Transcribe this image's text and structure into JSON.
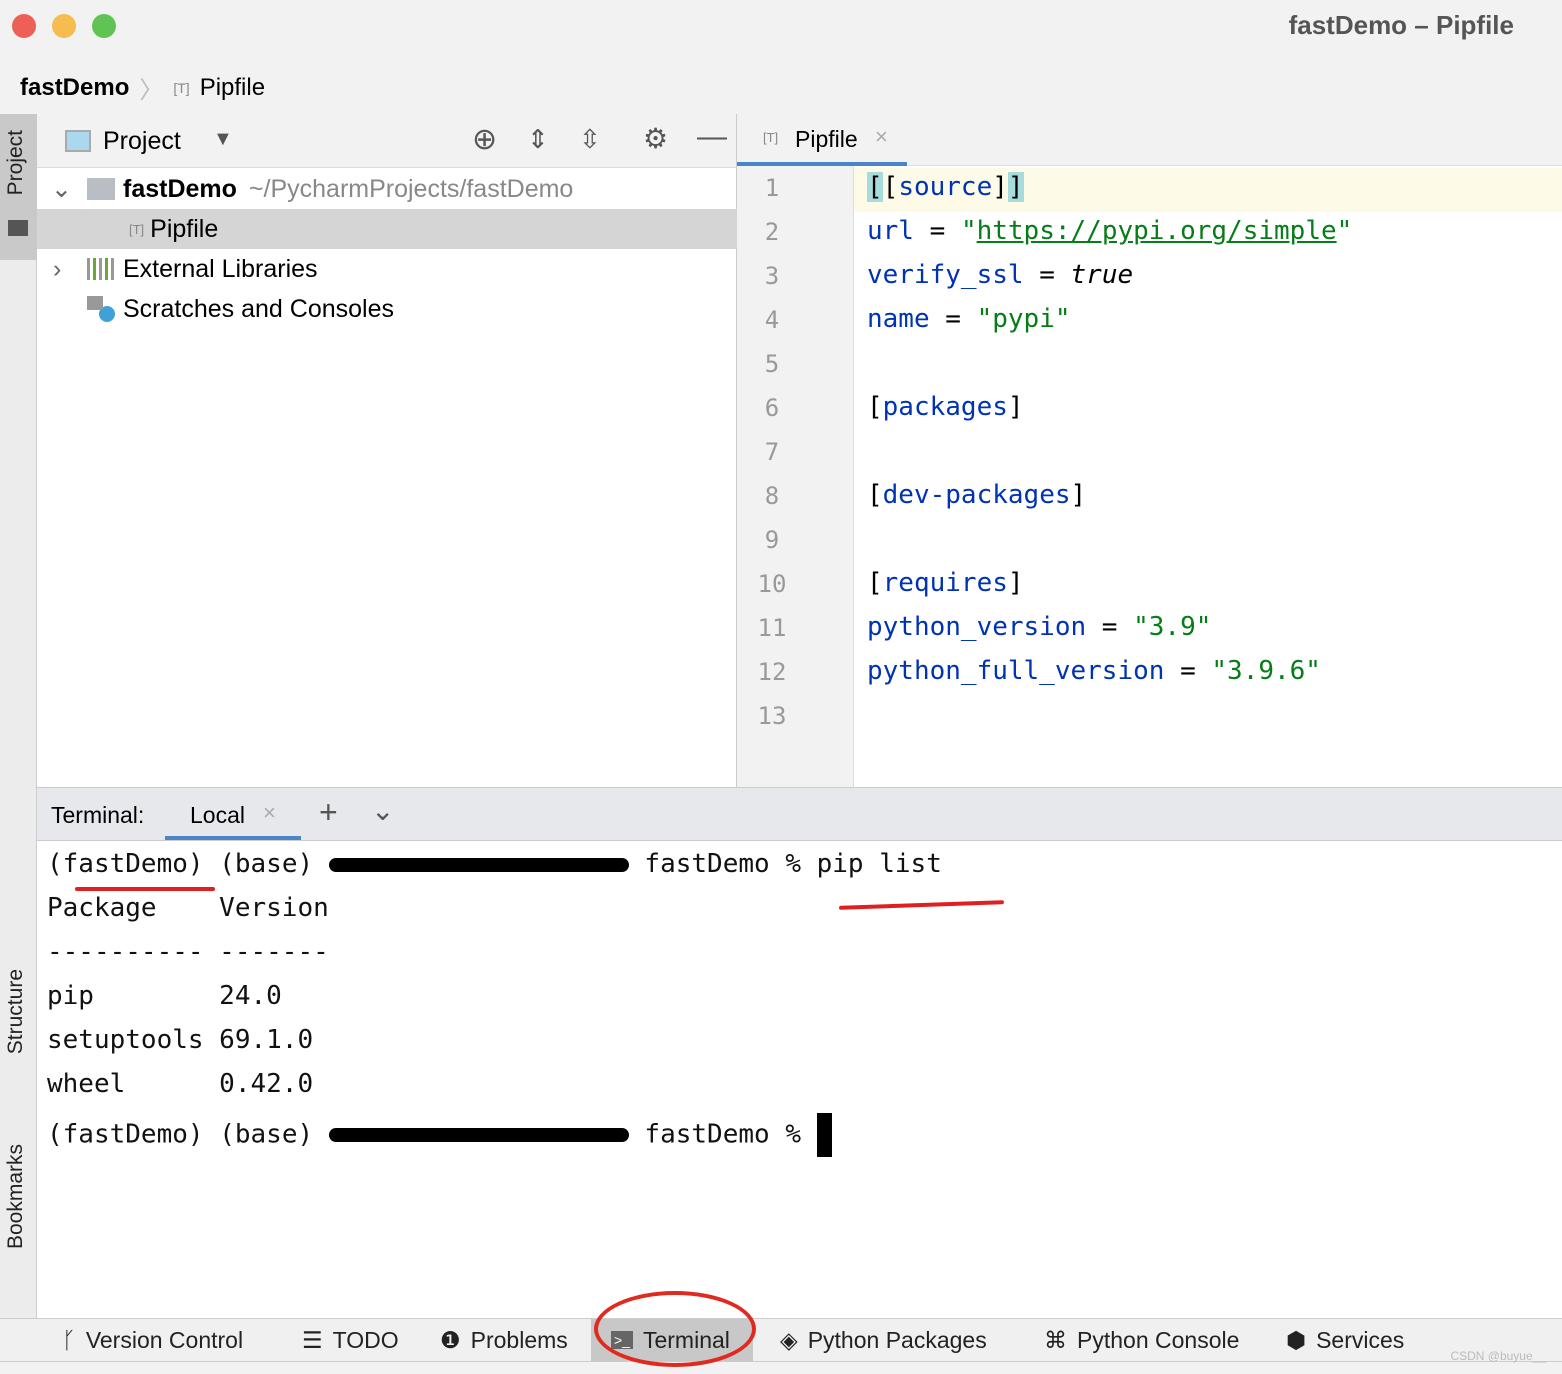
{
  "window": {
    "title": "fastDemo – Pipfile"
  },
  "breadcrumb": {
    "project": "fastDemo",
    "file": "Pipfile"
  },
  "side_tabs": {
    "project": "Project",
    "structure": "Structure",
    "bookmarks": "Bookmarks"
  },
  "project_panel": {
    "view_label": "Project",
    "tree": [
      {
        "label": "fastDemo",
        "path": "~/PycharmProjects/fastDemo"
      },
      {
        "label": "Pipfile"
      },
      {
        "label": "External Libraries"
      },
      {
        "label": "Scratches and Consoles"
      }
    ]
  },
  "editor": {
    "tab": "Pipfile",
    "line_numbers": [
      "1",
      "2",
      "3",
      "4",
      "5",
      "6",
      "7",
      "8",
      "9",
      "10",
      "11",
      "12",
      "13"
    ],
    "lines": {
      "l1": "source",
      "l2_key": "url",
      "l2_url": "https://pypi.org/simple",
      "l3_key": "verify_ssl",
      "l3_val": "true",
      "l4_key": "name",
      "l4_val": "\"pypi\"",
      "l6": "packages",
      "l8": "dev-packages",
      "l10": "requires",
      "l11_key": "python_version",
      "l11_val": "\"3.9\"",
      "l12_key": "python_full_version",
      "l12_val": "\"3.9.6\""
    }
  },
  "terminal": {
    "label": "Terminal:",
    "tab": "Local",
    "lines": {
      "prompt1_env": "(fastDemo)",
      "prompt1_rest": " (base) ",
      "prompt1_host": " fastDemo % pip list",
      "header": "Package    Version",
      "divider": "---------- -------",
      "rows": [
        "pip        24.0",
        "setuptools 69.1.0",
        "wheel      0.42.0"
      ],
      "prompt2_env": "(fastDemo)",
      "prompt2_rest": " (base) ",
      "prompt2_host": " fastDemo % "
    }
  },
  "bottom_tools": [
    "Version Control",
    "TODO",
    "Problems",
    "Terminal",
    "Python Packages",
    "Python Console",
    "Services"
  ],
  "watermark": "CSDN @buyue__"
}
